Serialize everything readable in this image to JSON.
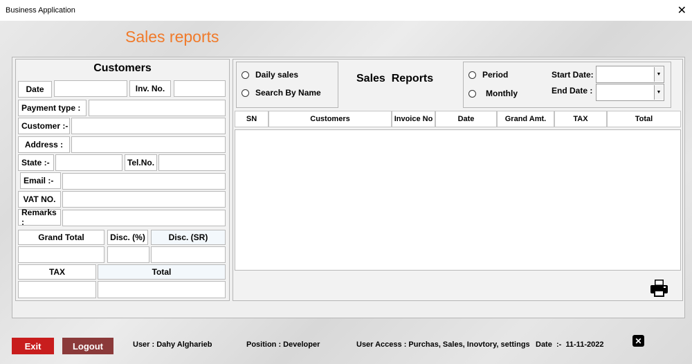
{
  "window": {
    "title": "Business Application"
  },
  "heading": "Sales reports",
  "customers": {
    "title": "Customers",
    "date_label": "Date",
    "inv_label": "Inv. No.",
    "payment_label": "Payment type :",
    "customer_label": "Customer :-",
    "address_label": "Address :",
    "state_label": "State :-",
    "tel_label": "Tel.No.",
    "email_label": "Email :-",
    "vat_label": "VAT NO.",
    "remarks_label": "Remarks :",
    "grand_total_label": "Grand Total",
    "disc_pct_label": "Disc. (%)",
    "disc_sr_label": "Disc. (SR)",
    "tax_label": "TAX",
    "total_label": "Total"
  },
  "reports": {
    "daily_sales": "Daily sales",
    "search_by_name": "Search By Name",
    "title": "Sales  Reports",
    "period": "Period",
    "monthly": "Monthly",
    "start_date": "Start Date:",
    "end_date": "End Date :",
    "columns": [
      "SN",
      "Customers",
      "Invoice No",
      "Date",
      "Grand Amt.",
      "TAX",
      "Total"
    ]
  },
  "icons": {
    "print": "printer-icon",
    "close_small": "close-icon"
  },
  "footer": {
    "exit": "Exit",
    "logout": "Logout",
    "user": "User : Dahy Algharieb",
    "position": "Position : Developer",
    "access": "User Access : Purchas, Sales, Inovtory, settings",
    "date": "Date  :-  11-11-2022"
  },
  "colors": {
    "accent": "#f07a2a",
    "exit_bg": "#c81d1d",
    "logout_bg": "#8b3a3a"
  }
}
